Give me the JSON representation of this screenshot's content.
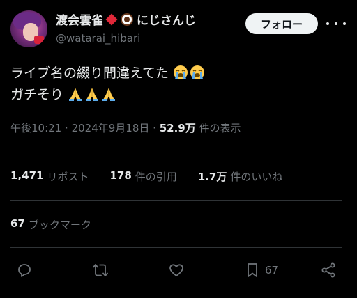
{
  "author": {
    "display_name": "渡会雲雀",
    "affiliation": "にじさんじ",
    "handle": "@watarai_hibari",
    "follow_label": "フォロー"
  },
  "tweet": {
    "line1": "ライブ名の綴り間違えてた",
    "line2": "ガチそり"
  },
  "meta": {
    "time": "午後10:21",
    "date": "2024年9月18日",
    "views_count": "52.9万",
    "views_label": "件の表示"
  },
  "stats": {
    "reposts_count": "1,471",
    "reposts_label": "リポスト",
    "quotes_count": "178",
    "quotes_label": "件の引用",
    "likes_count": "1.7万",
    "likes_label": "件のいいね",
    "bookmarks_count": "67",
    "bookmarks_label": "ブックマーク"
  },
  "actions": {
    "bookmark_count": "67"
  },
  "icons": {
    "reply": "reply-icon",
    "retweet": "retweet-icon",
    "like": "heart-icon",
    "bookmark": "bookmark-icon",
    "share": "share-icon",
    "more": "more-icon",
    "emoji_cry": "loudly-crying-face-icon",
    "emoji_pray": "folded-hands-icon",
    "diamond": "red-diamond-icon",
    "hot_beverage": "hot-beverage-icon"
  },
  "colors": {
    "background": "#000000",
    "text_primary": "#e7e9ea",
    "text_secondary": "#71767b",
    "divider": "#2f3336",
    "follow_button_bg": "#eff3f4"
  }
}
